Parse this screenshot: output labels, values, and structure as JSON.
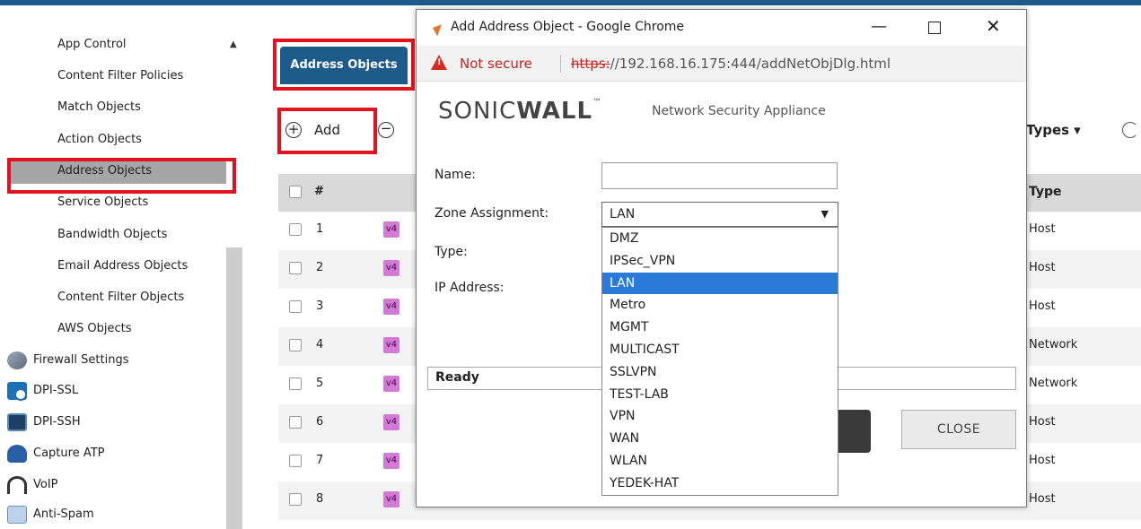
{
  "sidebar": {
    "items": [
      {
        "label": "App Control"
      },
      {
        "label": "Content Filter Policies"
      },
      {
        "label": "Match Objects"
      },
      {
        "label": "Action Objects"
      },
      {
        "label": "Address Objects",
        "selected": true
      },
      {
        "label": "Service Objects"
      },
      {
        "label": "Bandwidth Objects"
      },
      {
        "label": "Email Address Objects"
      },
      {
        "label": "Content Filter Objects"
      },
      {
        "label": "AWS Objects"
      }
    ],
    "sections": [
      {
        "label": "Firewall Settings",
        "icon": "firewall-icon"
      },
      {
        "label": "DPI-SSL",
        "icon": "dpi-ssl-icon"
      },
      {
        "label": "DPI-SSH",
        "icon": "dpi-ssh-icon"
      },
      {
        "label": "Capture ATP",
        "icon": "capture-atp-icon"
      },
      {
        "label": "VoIP",
        "icon": "voip-icon"
      },
      {
        "label": "Anti-Spam",
        "icon": "anti-spam-icon"
      }
    ]
  },
  "main": {
    "tab_label": "Address Objects",
    "add_label": "Add",
    "types_label": "Types ▾",
    "table": {
      "headers": {
        "num": "#",
        "type": "Type"
      },
      "rows": [
        {
          "num": "1",
          "ip": "v4",
          "type": "Host"
        },
        {
          "num": "2",
          "ip": "v4",
          "type": "Host"
        },
        {
          "num": "3",
          "ip": "v4",
          "type": "Host"
        },
        {
          "num": "4",
          "ip": "v4",
          "type": "Network"
        },
        {
          "num": "5",
          "ip": "v4",
          "type": "Network"
        },
        {
          "num": "6",
          "ip": "v4",
          "type": "Host"
        },
        {
          "num": "7",
          "ip": "v4",
          "type": "Host"
        },
        {
          "num": "8",
          "ip": "v4",
          "type": "Host"
        }
      ]
    }
  },
  "popup": {
    "window_title": "Add Address Object - Google Chrome",
    "not_secure": "Not secure",
    "url_scheme": "https:",
    "url_rest": "//192.168.16.175:444/addNetObjDlg.html",
    "logo_part1": "SONIC",
    "logo_part2": "WALL",
    "logo_tm": "™",
    "subtitle": "Network Security Appliance",
    "form": {
      "name_label": "Name:",
      "name_value": "",
      "zone_label": "Zone Assignment:",
      "zone_value": "LAN",
      "type_label": "Type:",
      "ip_label": "IP Address:"
    },
    "zone_options": [
      "DMZ",
      "IPSec_VPN",
      "LAN",
      "Metro",
      "MGMT",
      "MULTICAST",
      "SSLVPN",
      "TEST-LAB",
      "VPN",
      "WAN",
      "WLAN",
      "YEDEK-HAT"
    ],
    "zone_selected": "LAN",
    "status": "Ready",
    "close_label": "CLOSE"
  },
  "colors": {
    "brand_blue": "#1d5b8a",
    "highlight_red": "#e3121f",
    "selection_blue": "#2a7ad8",
    "v4_badge": "#d27ad6"
  }
}
